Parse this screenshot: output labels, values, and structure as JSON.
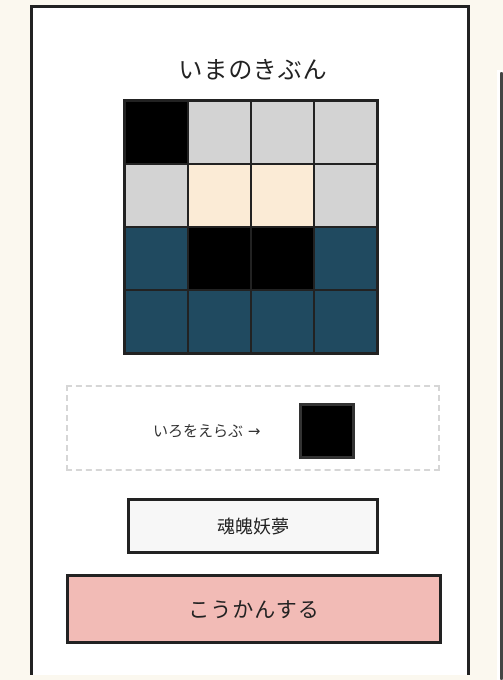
{
  "title": "いまのきぶん",
  "colors": {
    "black": "#000000",
    "gray": "#d3d3d3",
    "cream": "#fbebd6",
    "navy": "#204a60",
    "button_pink": "#f2bbb6"
  },
  "grid": [
    [
      "#000000",
      "#d3d3d3",
      "#d3d3d3",
      "#d3d3d3"
    ],
    [
      "#d3d3d3",
      "#fbebd6",
      "#fbebd6",
      "#d3d3d3"
    ],
    [
      "#204a60",
      "#000000",
      "#000000",
      "#204a60"
    ],
    [
      "#204a60",
      "#204a60",
      "#204a60",
      "#204a60"
    ]
  ],
  "picker": {
    "label": "いろをえらぶ →",
    "selected_color": "#000000"
  },
  "name_box": {
    "value": "魂魄妖夢"
  },
  "exchange_button": {
    "label": "こうかんする"
  }
}
